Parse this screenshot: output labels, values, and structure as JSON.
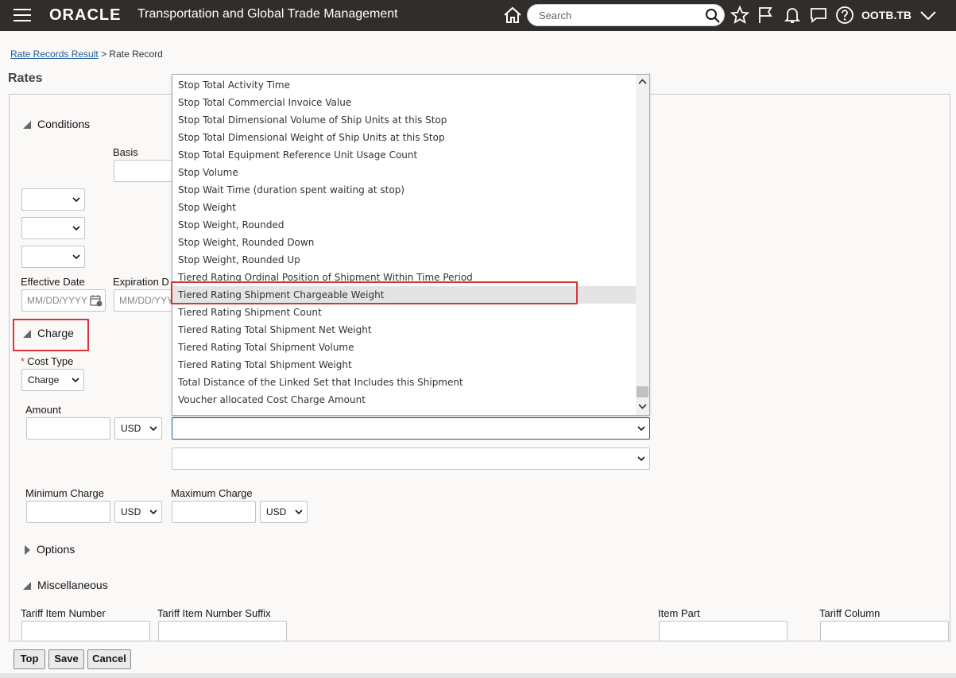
{
  "header": {
    "logo": "ORACLE",
    "app_title": "Transportation and Global Trade Management",
    "search_placeholder": "Search",
    "user": "OOTB.TB"
  },
  "breadcrumb": {
    "link": "Rate Records Result",
    "separator": ">",
    "current": "Rate Record"
  },
  "page_title": "Rates",
  "conditions": {
    "heading": "Conditions",
    "basis_label": "Basis",
    "effective_date_label": "Effective Date",
    "expiration_date_label": "Expiration D",
    "date_placeholder": "MM/DD/YYYY",
    "date_placeholder_short": "MM/DD/YYY"
  },
  "charge": {
    "heading": "Charge",
    "cost_type_label": "Cost Type",
    "cost_type_value": "Charge",
    "amount_label": "Amount",
    "amount_currency": "USD",
    "minimum_charge_label": "Minimum Charge",
    "minimum_currency": "USD",
    "maximum_charge_label": "Maximum Charge",
    "maximum_currency": "USD"
  },
  "options": {
    "heading": "Options"
  },
  "misc": {
    "heading": "Miscellaneous",
    "tariff_item_number_label": "Tariff Item Number",
    "tariff_item_suffix_label": "Tariff Item Number Suffix",
    "item_part_label": "Item Part",
    "tariff_column_label": "Tariff Column"
  },
  "dropdown": {
    "items": [
      "Stop Total Activity Time",
      "Stop Total Commercial Invoice Value",
      "Stop Total Dimensional Volume of Ship Units at this Stop",
      "Stop Total Dimensional Weight of Ship Units at this Stop",
      "Stop Total Equipment Reference Unit Usage Count",
      "Stop Volume",
      "Stop Wait Time (duration spent waiting at stop)",
      "Stop Weight",
      "Stop Weight, Rounded",
      "Stop Weight, Rounded Down",
      "Stop Weight, Rounded Up",
      "Tiered Rating Ordinal Position of Shipment Within Time Period",
      "Tiered Rating Shipment Chargeable Weight",
      "Tiered Rating Shipment Count",
      "Tiered Rating Total Shipment Net Weight",
      "Tiered Rating Total Shipment Volume",
      "Tiered Rating Total Shipment Weight",
      "Total Distance of the Linked Set that Includes this Shipment",
      "Voucher allocated Cost Charge Amount"
    ],
    "highlighted": "Tiered Rating Shipment Chargeable Weight"
  },
  "buttons": {
    "top": "Top",
    "save": "Save",
    "cancel": "Cancel"
  }
}
